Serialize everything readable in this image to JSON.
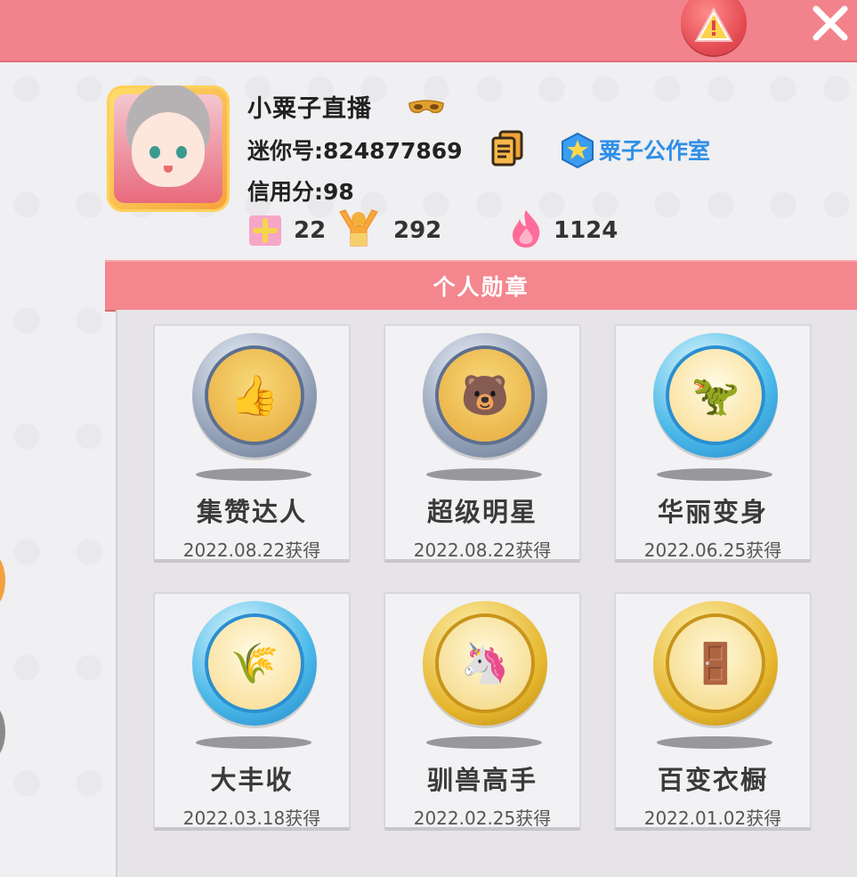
{
  "header": {
    "warning_icon": "warning-triangle-icon",
    "close_icon": "close-x-icon",
    "accent_color": "#f2838c"
  },
  "profile": {
    "name": "小粟子直播",
    "mini_id_label": "迷你号:824877869",
    "studio_name": "粟子公作室",
    "credit_label": "信用分:98",
    "stats": {
      "likes": "22",
      "fans": "292",
      "popularity": "1124"
    }
  },
  "medals": {
    "title": "个人勋章",
    "items": [
      {
        "name": "集赞达人",
        "date": "2022.08.22获得",
        "tier": "silver",
        "icon": "thumbs-up-icon"
      },
      {
        "name": "超级明星",
        "date": "2022.08.22获得",
        "tier": "silver",
        "icon": "star-bear-icon"
      },
      {
        "name": "华丽变身",
        "date": "2022.06.25获得",
        "tier": "crystal",
        "icon": "dino-costume-icon"
      },
      {
        "name": "大丰收",
        "date": "2022.03.18获得",
        "tier": "crystal",
        "icon": "harvest-icon"
      },
      {
        "name": "驯兽高手",
        "date": "2022.02.25获得",
        "tier": "gold",
        "icon": "unicorn-rider-icon"
      },
      {
        "name": "百变衣橱",
        "date": "2022.01.02获得",
        "tier": "gold",
        "icon": "wardrobe-icon"
      }
    ]
  }
}
